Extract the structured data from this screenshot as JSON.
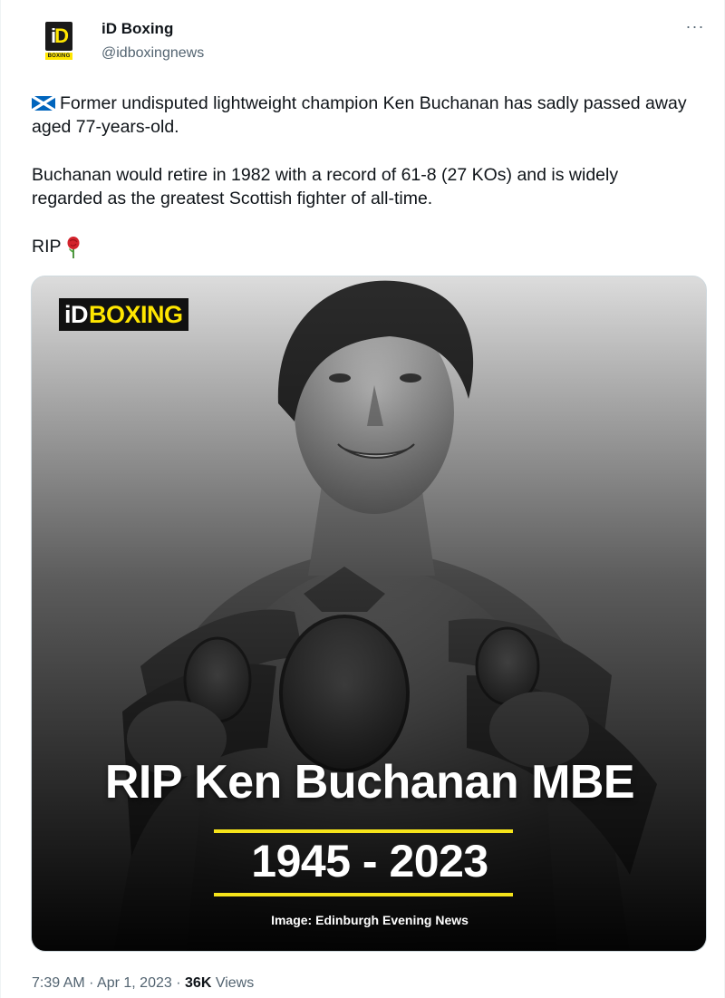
{
  "author": {
    "display_name": "iD Boxing",
    "handle": "@idboxingnews",
    "avatar_logo_main_i": "i",
    "avatar_logo_main_d": "D",
    "avatar_logo_sub": "BOXING"
  },
  "more_label": "···",
  "tweet": {
    "paragraph_1": "Former undisputed lightweight champion Ken Buchanan has sadly passed away aged 77-years-old.",
    "paragraph_2": "Buchanan would retire in 1982 with a record of 61-8 (27 KOs) and is widely regarded as the greatest Scottish fighter of all-time.",
    "paragraph_3": "RIP",
    "flag_emoji": "scotland-flag-icon",
    "rose_emoji": "rose-icon"
  },
  "media": {
    "brand_id": "iD",
    "brand_text": "BOXING",
    "title": "RIP Ken Buchanan MBE",
    "years": "1945 - 2023",
    "credit": "Image: Edinburgh Evening News",
    "accent_color": "#f5e31a"
  },
  "footer": {
    "time": "7:39 AM",
    "separator": "·",
    "date": "Apr 1, 2023",
    "views_count": "36K",
    "views_label": "Views"
  }
}
